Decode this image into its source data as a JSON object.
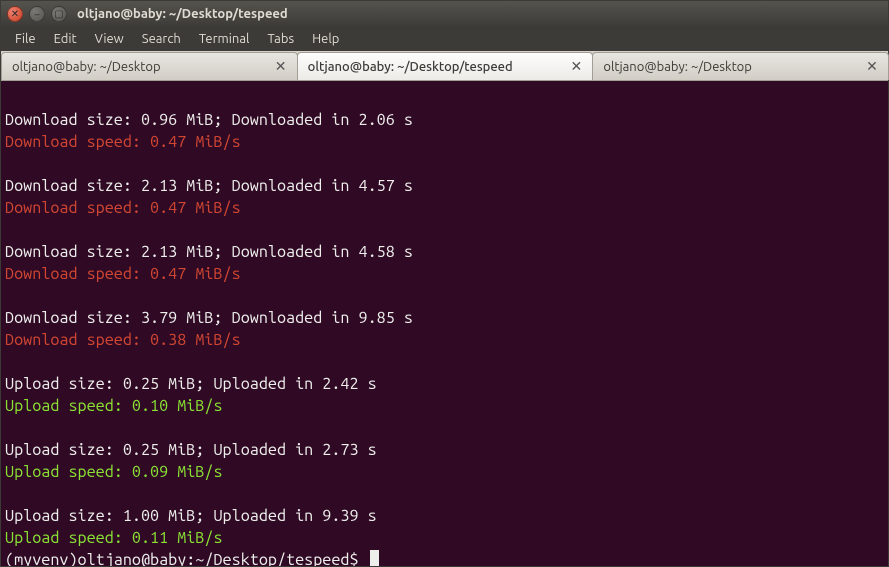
{
  "window": {
    "title": "oltjano@baby: ~/Desktop/tespeed"
  },
  "menubar": {
    "items": [
      "File",
      "Edit",
      "View",
      "Search",
      "Terminal",
      "Tabs",
      "Help"
    ]
  },
  "tabs": [
    {
      "label": "oltjano@baby: ~/Desktop",
      "active": false
    },
    {
      "label": "oltjano@baby: ~/Desktop/tespeed",
      "active": true
    },
    {
      "label": "oltjano@baby: ~/Desktop",
      "active": false
    }
  ],
  "terminal": {
    "blocks": [
      {
        "info_prefix": "Download size: ",
        "size": "0.96 MiB",
        "mid": "; Downloaded in ",
        "time": "2.06 s",
        "speed_prefix": "Download speed: ",
        "speed": "0.47 MiB/s",
        "kind": "download"
      },
      {
        "info_prefix": "Download size: ",
        "size": "2.13 MiB",
        "mid": "; Downloaded in ",
        "time": "4.57 s",
        "speed_prefix": "Download speed: ",
        "speed": "0.47 MiB/s",
        "kind": "download"
      },
      {
        "info_prefix": "Download size: ",
        "size": "2.13 MiB",
        "mid": "; Downloaded in ",
        "time": "4.58 s",
        "speed_prefix": "Download speed: ",
        "speed": "0.47 MiB/s",
        "kind": "download"
      },
      {
        "info_prefix": "Download size: ",
        "size": "3.79 MiB",
        "mid": "; Downloaded in ",
        "time": "9.85 s",
        "speed_prefix": "Download speed: ",
        "speed": "0.38 MiB/s",
        "kind": "download"
      },
      {
        "info_prefix": "Upload size: ",
        "size": "0.25 MiB",
        "mid": "; Uploaded in ",
        "time": "2.42 s",
        "speed_prefix": "Upload speed: ",
        "speed": "0.10 MiB/s",
        "kind": "upload"
      },
      {
        "info_prefix": "Upload size: ",
        "size": "0.25 MiB",
        "mid": "; Uploaded in ",
        "time": "2.73 s",
        "speed_prefix": "Upload speed: ",
        "speed": "0.09 MiB/s",
        "kind": "upload"
      },
      {
        "info_prefix": "Upload size: ",
        "size": "1.00 MiB",
        "mid": "; Uploaded in ",
        "time": "9.39 s",
        "speed_prefix": "Upload speed: ",
        "speed": "0.11 MiB/s",
        "kind": "upload"
      }
    ],
    "prompt": "(myvenv)oltjano@baby:~/Desktop/tespeed$ "
  }
}
